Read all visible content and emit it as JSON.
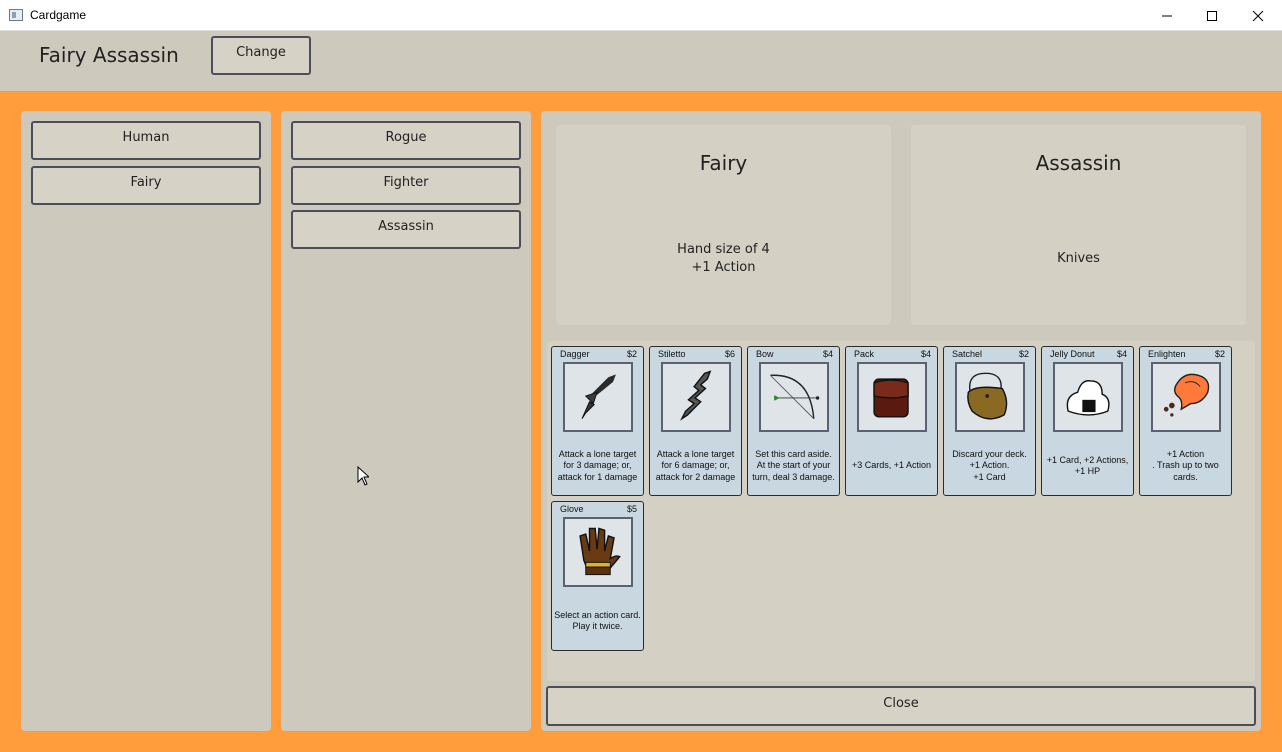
{
  "window": {
    "title": "Cardgame"
  },
  "header": {
    "character_name": "Fairy Assassin",
    "change_label": "Change"
  },
  "races": [
    {
      "label": "Human"
    },
    {
      "label": "Fairy"
    }
  ],
  "classes": [
    {
      "label": "Rogue"
    },
    {
      "label": "Fighter"
    },
    {
      "label": "Assassin"
    }
  ],
  "race_info": {
    "title": "Fairy",
    "description": "Hand size of 4\n+1  Action"
  },
  "class_info": {
    "title": "Assassin",
    "description": "Knives"
  },
  "cards": [
    {
      "name": "Dagger",
      "cost": "$2",
      "text": "Attack a lone target\nfor 3 damage; or,\nattack for 1 damage",
      "icon": "dagger-icon"
    },
    {
      "name": "Stiletto",
      "cost": "$6",
      "text": "Attack a lone target\nfor 6 damage; or,\nattack for 2 damage",
      "icon": "stiletto-icon"
    },
    {
      "name": "Bow",
      "cost": "$4",
      "text": "Set this card aside.\nAt the start of your\nturn, deal 3 damage.",
      "icon": "bow-icon"
    },
    {
      "name": "Pack",
      "cost": "$4",
      "text": "+3 Cards, +1 Action",
      "icon": "backpack-icon"
    },
    {
      "name": "Satchel",
      "cost": "$2",
      "text": "Discard your deck.\n+1 Action.\n+1 Card",
      "icon": "satchel-icon"
    },
    {
      "name": "Jelly Donut",
      "cost": "$4",
      "text": "+1 Card, +2 Actions,\n+1 HP",
      "icon": "jelly-donut-icon"
    },
    {
      "name": "Enlighten",
      "cost": "$2",
      "text": "+1 Action\n. Trash up to two\ncards.",
      "icon": "enlighten-icon"
    },
    {
      "name": "Glove",
      "cost": "$5",
      "text": "Select an action card.\nPlay it twice.",
      "icon": "glove-icon"
    }
  ],
  "footer": {
    "close_label": "Close"
  },
  "colors": {
    "background_orange": "#ff9d3d",
    "panel": "#cdc9bc",
    "card": "#c8d7e0",
    "button_border": "#4b4e5a"
  }
}
